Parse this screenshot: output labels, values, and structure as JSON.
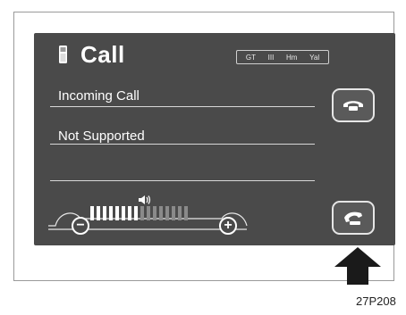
{
  "screen": {
    "title": "Call",
    "status": {
      "items": [
        "GT",
        "III",
        "Hm",
        "Yal"
      ]
    },
    "lines": [
      "Incoming Call",
      "Not Supported"
    ],
    "volume": {
      "minus": "−",
      "plus": "+",
      "level": 0.5,
      "segments_total": 16,
      "segments_on": 8
    }
  },
  "figure_code": "27P208",
  "colors": {
    "screen_bg": "#4a4a4a",
    "text": "#ffffff",
    "bar_on": "#ffffff",
    "bar_off": "#8a8a8a"
  },
  "icons": [
    "phone-handset-icon",
    "call-off-icon",
    "call-on-icon",
    "volume-speaker-icon",
    "arrow-up-icon"
  ]
}
